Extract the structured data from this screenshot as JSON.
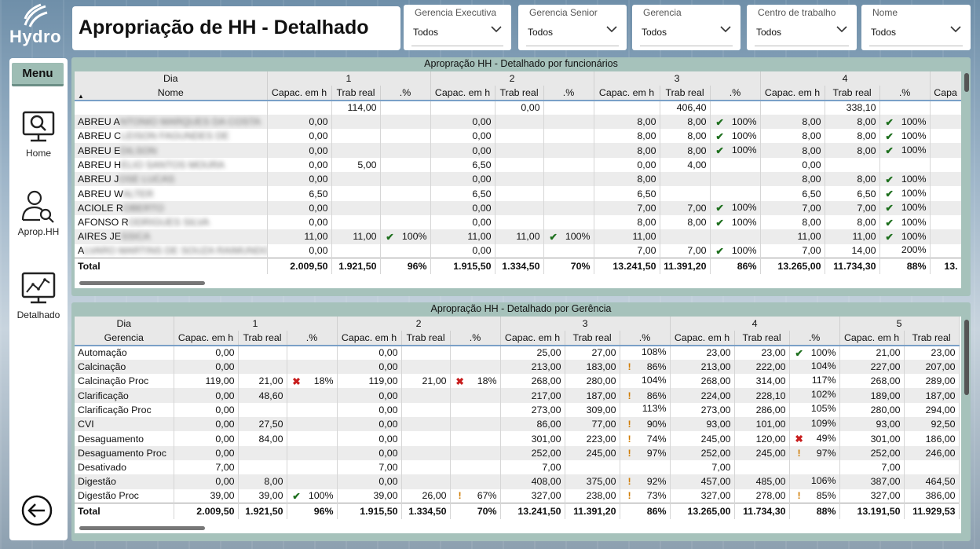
{
  "app": {
    "brand": "Hydro",
    "title": "Apropriação de HH - Detalhado"
  },
  "nav": {
    "menu_label": "Menu",
    "items": [
      {
        "label": "Home",
        "icon": "monitor-search-icon"
      },
      {
        "label": "Aprop.HH",
        "icon": "user-search-icon"
      },
      {
        "label": "Detalhado",
        "icon": "chart-monitor-icon"
      }
    ],
    "back_icon": "back-arrow-icon"
  },
  "filters": [
    {
      "label": "Gerencia Executiva",
      "value": "Todos"
    },
    {
      "label": "Gerencia Senior",
      "value": "Todos"
    },
    {
      "label": "Gerencia",
      "value": "Todos"
    },
    {
      "label": "Centro de trabalho",
      "value": "Todos"
    },
    {
      "label": "Nome",
      "value": "Todos"
    }
  ],
  "colors": {
    "panel": "#a6c2bb",
    "check": "#1d6f1d",
    "cross": "#c81e1e",
    "warning": "#d07b00"
  },
  "panel1": {
    "title": "Apropração HH - Detalhado por funcionários",
    "row_header_top": "Dia",
    "row_header": "Nome",
    "sort_icon": "sort-ascending-icon",
    "days": [
      "1",
      "2",
      "3",
      "4"
    ],
    "day5_partial": "Capa",
    "cols": [
      "Capac. em h",
      "Trab real",
      ".%"
    ],
    "blank_row": [
      "",
      "",
      "114,00",
      "",
      "",
      "0,00",
      "",
      "",
      "406,40",
      "",
      "",
      "338,10",
      ""
    ],
    "rows": [
      {
        "name": "ABREU A",
        "hidden": "NTONIO MARQUES DA COSTA",
        "c": [
          "0,00",
          "",
          "",
          "0,00",
          "",
          "",
          "8,00",
          "8,00",
          "100%",
          "8,00",
          "8,00",
          "100%"
        ],
        "i": [
          "",
          "",
          "chk",
          "chk"
        ]
      },
      {
        "name": "ABREU C",
        "hidden": "LEISON FAGUNDES DE",
        "c": [
          "0,00",
          "",
          "",
          "0,00",
          "",
          "",
          "8,00",
          "8,00",
          "100%",
          "8,00",
          "8,00",
          "100%"
        ],
        "i": [
          "",
          "",
          "chk",
          "chk"
        ]
      },
      {
        "name": "ABREU E",
        "hidden": "DILSON",
        "c": [
          "0,00",
          "",
          "",
          "0,00",
          "",
          "",
          "8,00",
          "8,00",
          "100%",
          "8,00",
          "8,00",
          "100%"
        ],
        "i": [
          "",
          "",
          "chk",
          "chk"
        ]
      },
      {
        "name": "ABREU H",
        "hidden": "ELIO SANTOS MOURA",
        "c": [
          "0,00",
          "5,00",
          "",
          "6,50",
          "",
          "",
          "0,00",
          "4,00",
          "",
          "0,00",
          "",
          ""
        ],
        "i": [
          "",
          "",
          "",
          ""
        ]
      },
      {
        "name": "ABREU J",
        "hidden": "OSE LUCAS",
        "c": [
          "0,00",
          "",
          "",
          "0,00",
          "",
          "",
          "8,00",
          "",
          "",
          "8,00",
          "8,00",
          "100%"
        ],
        "i": [
          "",
          "",
          "",
          "chk"
        ]
      },
      {
        "name": "ABREU W",
        "hidden": "ALTER",
        "c": [
          "6,50",
          "",
          "",
          "6,50",
          "",
          "",
          "6,50",
          "",
          "",
          "6,50",
          "6,50",
          "100%"
        ],
        "i": [
          "",
          "",
          "",
          "chk"
        ]
      },
      {
        "name": "ACIOLE R",
        "hidden": "OBERTO",
        "c": [
          "0,00",
          "",
          "",
          "0,00",
          "",
          "",
          "7,00",
          "7,00",
          "100%",
          "7,00",
          "7,00",
          "100%"
        ],
        "i": [
          "",
          "",
          "chk",
          "chk"
        ]
      },
      {
        "name": "AFONSO R",
        "hidden": "ODRIGUES SILVA",
        "c": [
          "0,00",
          "",
          "",
          "0,00",
          "",
          "",
          "8,00",
          "8,00",
          "100%",
          "8,00",
          "8,00",
          "100%"
        ],
        "i": [
          "",
          "",
          "chk",
          "chk"
        ]
      },
      {
        "name": "AIRES JE",
        "hidden": "SSICA",
        "c": [
          "11,00",
          "11,00",
          "100%",
          "11,00",
          "11,00",
          "100%",
          "11,00",
          "",
          "",
          "11,00",
          "11,00",
          "100%"
        ],
        "i": [
          "chk",
          "chk",
          "",
          "chk"
        ]
      },
      {
        "name": "A",
        "hidden": "LVARO MARTINS DE SOUZA RAIMUNDO",
        "c": [
          "0,00",
          "",
          "",
          "0,00",
          "",
          "",
          "7,00",
          "7,00",
          "100%",
          "7,00",
          "14,00",
          "200%"
        ],
        "i": [
          "",
          "",
          "chk",
          ""
        ]
      }
    ],
    "total": {
      "label": "Total",
      "c": [
        "2.009,50",
        "1.921,50",
        "96%",
        "1.915,50",
        "1.334,50",
        "70%",
        "13.241,50",
        "11.391,20",
        "86%",
        "13.265,00",
        "11.734,30",
        "88%"
      ],
      "extra": "13."
    }
  },
  "panel2": {
    "title": "Apropração HH - Detalhado por Gerência",
    "row_header_top": "Dia",
    "row_header": "Gerencia",
    "days": [
      "1",
      "2",
      "3",
      "4",
      "5"
    ],
    "cols": [
      "Capac. em h",
      "Trab real",
      ".%"
    ],
    "rows": [
      {
        "name": "Automação",
        "c": [
          "0,00",
          "",
          "",
          "0,00",
          "",
          "",
          "25,00",
          "27,00",
          "108%",
          "23,00",
          "23,00",
          "100%",
          "21,00",
          "23,00"
        ],
        "i": [
          "",
          "",
          "",
          "chk"
        ]
      },
      {
        "name": "Calcinação",
        "c": [
          "0,00",
          "",
          "",
          "0,00",
          "",
          "",
          "213,00",
          "183,00",
          "86%",
          "213,00",
          "222,00",
          "104%",
          "227,00",
          "207,00"
        ],
        "i": [
          "",
          "",
          "exc",
          ""
        ]
      },
      {
        "name": "Calcinação Proc",
        "c": [
          "119,00",
          "21,00",
          "18%",
          "119,00",
          "21,00",
          "18%",
          "268,00",
          "280,00",
          "104%",
          "268,00",
          "314,00",
          "117%",
          "268,00",
          "289,00"
        ],
        "i": [
          "crs",
          "crs",
          "",
          ""
        ]
      },
      {
        "name": "Clarificação",
        "c": [
          "0,00",
          "48,60",
          "",
          "0,00",
          "",
          "",
          "217,00",
          "187,00",
          "86%",
          "224,00",
          "228,10",
          "102%",
          "189,00",
          "187,00"
        ],
        "i": [
          "",
          "",
          "exc",
          ""
        ]
      },
      {
        "name": "Clarificação Proc",
        "c": [
          "0,00",
          "",
          "",
          "0,00",
          "",
          "",
          "273,00",
          "309,00",
          "113%",
          "273,00",
          "286,00",
          "105%",
          "280,00",
          "294,00"
        ],
        "i": [
          "",
          "",
          "",
          ""
        ]
      },
      {
        "name": "CVI",
        "c": [
          "0,00",
          "27,50",
          "",
          "0,00",
          "",
          "",
          "86,00",
          "77,00",
          "90%",
          "93,00",
          "101,00",
          "109%",
          "93,00",
          "92,50"
        ],
        "i": [
          "",
          "",
          "exc",
          ""
        ]
      },
      {
        "name": "Desaguamento",
        "c": [
          "0,00",
          "84,00",
          "",
          "0,00",
          "",
          "",
          "301,00",
          "223,00",
          "74%",
          "245,00",
          "120,00",
          "49%",
          "301,00",
          "186,00"
        ],
        "i": [
          "",
          "",
          "exc",
          "crs"
        ]
      },
      {
        "name": "Desaguamento Proc",
        "c": [
          "0,00",
          "",
          "",
          "0,00",
          "",
          "",
          "252,00",
          "245,00",
          "97%",
          "252,00",
          "245,00",
          "97%",
          "252,00",
          "246,00"
        ],
        "i": [
          "",
          "",
          "exc",
          "exc"
        ]
      },
      {
        "name": "Desativado",
        "c": [
          "7,00",
          "",
          "",
          "7,00",
          "",
          "",
          "7,00",
          "",
          "",
          "7,00",
          "",
          "",
          "7,00",
          ""
        ],
        "i": [
          "",
          "",
          "",
          ""
        ]
      },
      {
        "name": "Digestão",
        "c": [
          "0,00",
          "8,00",
          "",
          "0,00",
          "",
          "",
          "408,00",
          "375,00",
          "92%",
          "457,00",
          "485,00",
          "106%",
          "387,00",
          "464,50"
        ],
        "i": [
          "",
          "",
          "exc",
          ""
        ]
      },
      {
        "name": "Digestão Proc",
        "c": [
          "39,00",
          "39,00",
          "100%",
          "39,00",
          "26,00",
          "67%",
          "327,00",
          "238,00",
          "73%",
          "327,00",
          "278,00",
          "85%",
          "327,00",
          "386,00"
        ],
        "i": [
          "chk",
          "exc",
          "exc",
          "exc"
        ]
      }
    ],
    "total": {
      "label": "Total",
      "c": [
        "2.009,50",
        "1.921,50",
        "96%",
        "1.915,50",
        "1.334,50",
        "70%",
        "13.241,50",
        "11.391,20",
        "86%",
        "13.265,00",
        "11.734,30",
        "88%",
        "13.191,50",
        "11.929,53"
      ]
    }
  }
}
